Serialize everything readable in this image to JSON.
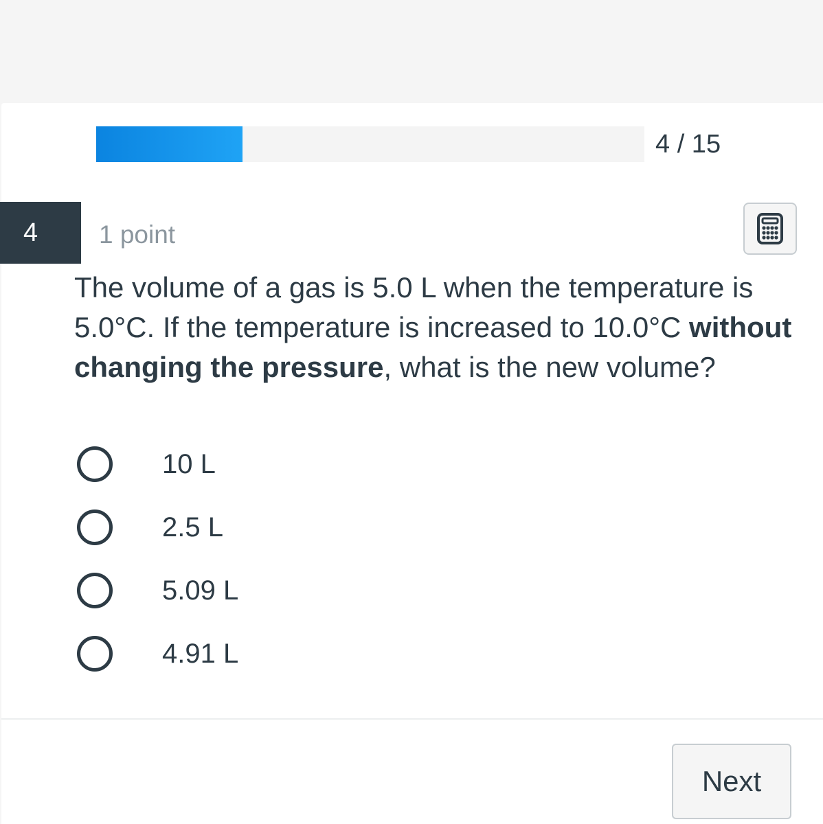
{
  "progress": {
    "current": 4,
    "total": 15,
    "fraction": 0.267,
    "label": "4 / 15",
    "fill_color": "#1fa3f5"
  },
  "question": {
    "number": "4",
    "points": "1 point",
    "text_part1": "The volume of a gas is 5.0 L when the temperature is 5.0°C. If the temperature is increased to 10.0°C ",
    "text_bold": "without changing the pressure",
    "text_part2": ", what is the new volume?",
    "calculator_icon": "calculator-icon"
  },
  "answers": [
    {
      "label": "10 L",
      "selected": false
    },
    {
      "label": "2.5 L",
      "selected": false
    },
    {
      "label": "5.09 L",
      "selected": false
    },
    {
      "label": "4.91 L",
      "selected": false
    }
  ],
  "footer": {
    "next_label": "Next"
  }
}
